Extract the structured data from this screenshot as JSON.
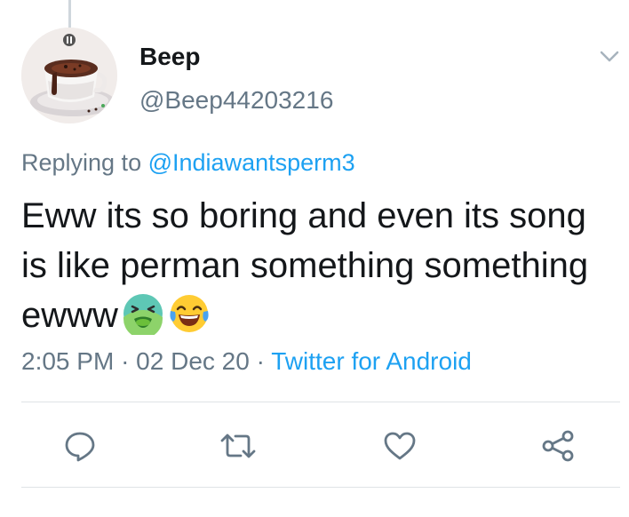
{
  "tweet": {
    "display_name": "Beep",
    "handle": "@Beep44203216",
    "replying_prefix": "Replying to",
    "replying_to": "@Indiawantsperm3",
    "text": "Eww its so boring and even its song is like perman something something ewww",
    "emojis": [
      "nauseated-face-icon",
      "face-with-tears-of-joy-icon"
    ],
    "time": "2:05 PM",
    "separator": "·",
    "date": "02 Dec 20",
    "source": "Twitter for Android"
  },
  "actions": [
    "reply-icon",
    "retweet-icon",
    "like-icon",
    "share-icon"
  ],
  "colors": {
    "text": "#14171a",
    "secondary": "#657786",
    "accent": "#1da1f2"
  }
}
